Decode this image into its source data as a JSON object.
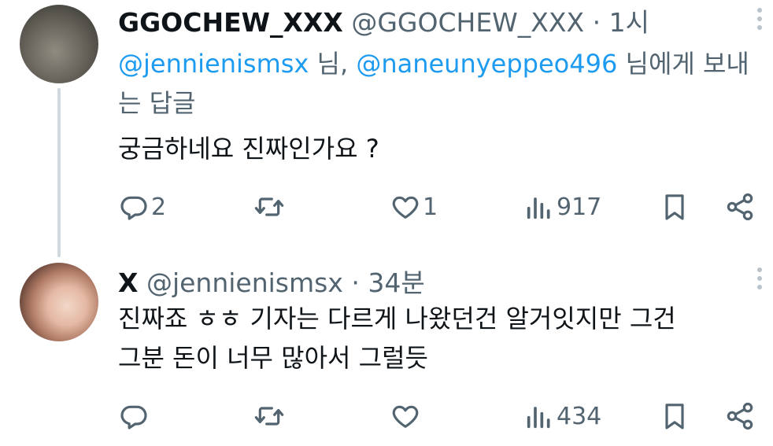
{
  "tweets": [
    {
      "display_name": "GGOCHEW_XXX",
      "handle": "@GGOCHEW_XXX",
      "separator": "·",
      "time": "1시",
      "replying_to": {
        "mention1": "@jennienismsx",
        "suffix1": " 님, ",
        "mention2": "@naneunyeppeo496",
        "suffix2": " 님에게 보내는 답글"
      },
      "text": "궁금하네요 진짜인가요 ?",
      "stats": {
        "replies": "2",
        "retweets": "",
        "likes": "1",
        "views": "917"
      },
      "icons": [
        "avatar",
        "more-icon",
        "reply-icon",
        "retweet-icon",
        "like-icon",
        "views-icon",
        "bookmark-icon",
        "share-icon"
      ]
    },
    {
      "display_name": "X",
      "handle": "@jennienismsx",
      "separator": "·",
      "time": "34분",
      "text_lines": [
        "진짜죠 ㅎㅎ 기자는 다르게 나왔던건 알거잇지만 그건",
        "그분 돈이 너무 많아서 그럴듯"
      ],
      "stats": {
        "replies": "",
        "retweets": "",
        "likes": "",
        "views": "434"
      },
      "icons": [
        "avatar",
        "more-icon",
        "reply-icon",
        "retweet-icon",
        "like-icon",
        "views-icon",
        "bookmark-icon",
        "share-icon"
      ]
    }
  ],
  "colors": {
    "text": "#0f1419",
    "secondary": "#536471",
    "link": "#1d9bf0",
    "thread_line": "#cfd9de"
  }
}
